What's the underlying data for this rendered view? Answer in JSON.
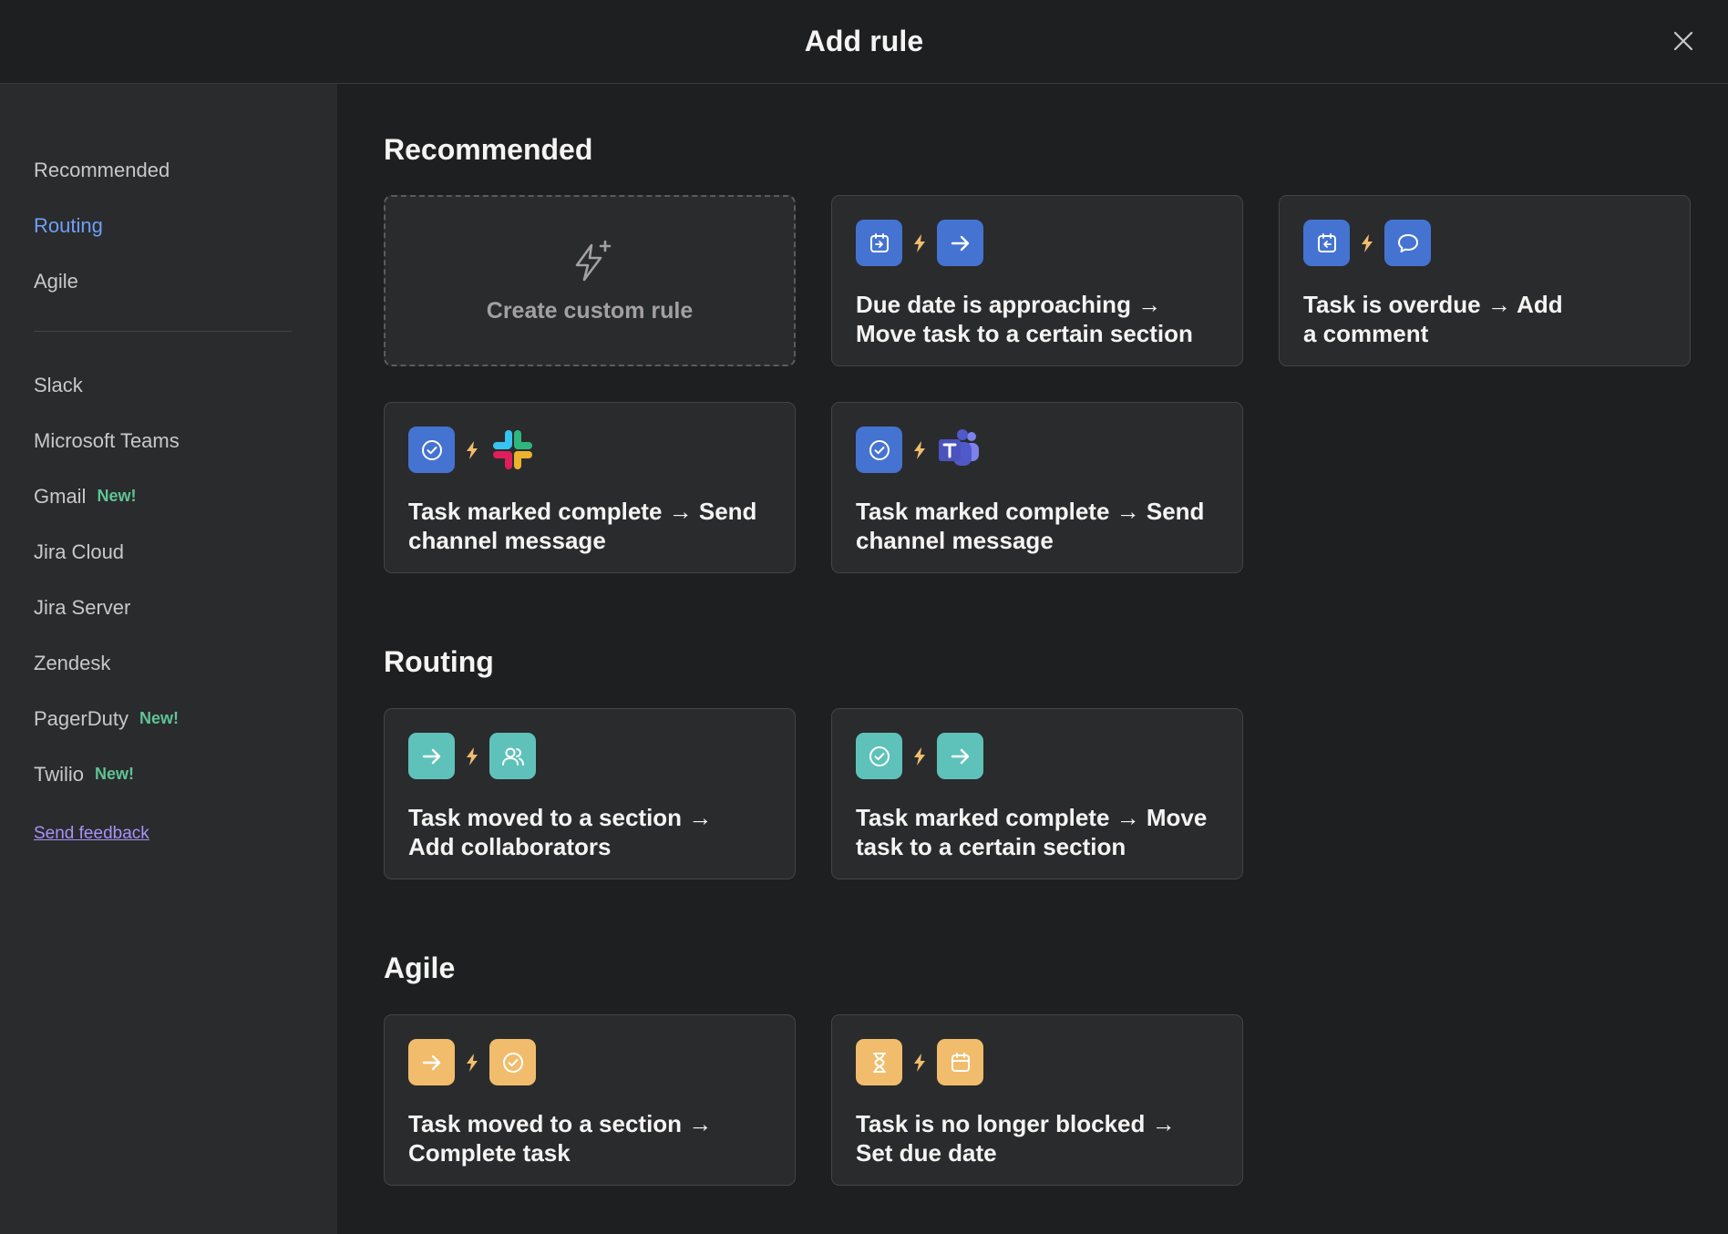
{
  "header": {
    "title": "Add rule"
  },
  "sidebar": {
    "group1": [
      {
        "label": "Recommended",
        "active": false
      },
      {
        "label": "Routing",
        "active": true
      },
      {
        "label": "Agile",
        "active": false
      }
    ],
    "group2": [
      {
        "label": "Slack",
        "badge": ""
      },
      {
        "label": "Microsoft Teams",
        "badge": ""
      },
      {
        "label": "Gmail",
        "badge": "New!"
      },
      {
        "label": "Jira Cloud",
        "badge": ""
      },
      {
        "label": "Jira Server",
        "badge": ""
      },
      {
        "label": "Zendesk",
        "badge": ""
      },
      {
        "label": "PagerDuty",
        "badge": "New!"
      },
      {
        "label": "Twilio",
        "badge": "New!"
      }
    ],
    "feedback": "Send feedback"
  },
  "sections": {
    "recommended": {
      "title": "Recommended",
      "custom_label": "Create custom rule",
      "cards": [
        {
          "text": "Due date is approaching → Move task to a certain section",
          "icon1": "calendar-arrow-icon",
          "icon2": "arrow-right-icon"
        },
        {
          "text": "Task is overdue → Add a comment",
          "icon1": "calendar-overdue-icon",
          "icon2": "comment-icon"
        },
        {
          "text": "Task marked complete → Send channel message",
          "icon1": "check-circle-icon",
          "icon2": "slack-icon"
        },
        {
          "text": "Task marked complete → Send channel message",
          "icon1": "check-circle-icon",
          "icon2": "teams-icon"
        }
      ]
    },
    "routing": {
      "title": "Routing",
      "cards": [
        {
          "text": "Task moved to a section → Add collaborators",
          "icon1": "arrow-right-icon",
          "icon2": "people-icon"
        },
        {
          "text": "Task marked complete → Move task to a certain section",
          "icon1": "check-circle-icon",
          "icon2": "arrow-right-icon"
        }
      ]
    },
    "agile": {
      "title": "Agile",
      "cards": [
        {
          "text": "Task moved to a section → Complete task",
          "icon1": "arrow-right-icon",
          "icon2": "check-circle-icon"
        },
        {
          "text": "Task is no longer blocked → Set due date",
          "icon1": "hourglass-icon",
          "icon2": "calendar-icon"
        }
      ]
    }
  },
  "colors": {
    "blue": "#4573d2",
    "teal": "#5ec2ba",
    "yellow": "#f1bd6c",
    "bolt": "#f1bd6c",
    "active_nav": "#6f9ff7",
    "new_badge": "#5fc396",
    "link": "#a992f6"
  }
}
